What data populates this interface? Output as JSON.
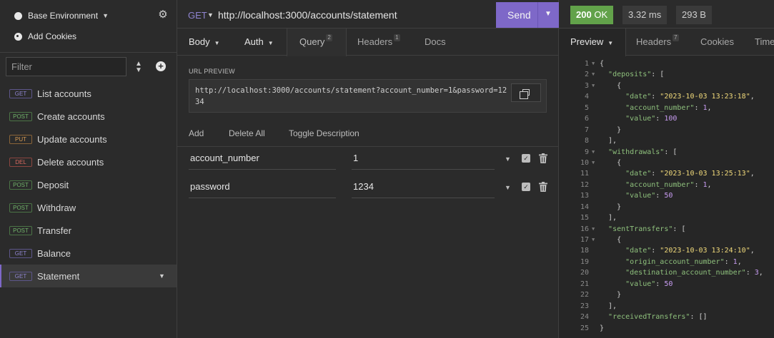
{
  "sidebar": {
    "environment": "Base Environment",
    "add_cookies": "Add Cookies",
    "filter_placeholder": "Filter",
    "requests": [
      {
        "method": "GET",
        "name": "List accounts"
      },
      {
        "method": "POST",
        "name": "Create accounts"
      },
      {
        "method": "PUT",
        "name": "Update accounts"
      },
      {
        "method": "DEL",
        "name": "Delete accounts"
      },
      {
        "method": "POST",
        "name": "Deposit"
      },
      {
        "method": "POST",
        "name": "Withdraw"
      },
      {
        "method": "POST",
        "name": "Transfer"
      },
      {
        "method": "GET",
        "name": "Balance"
      },
      {
        "method": "GET",
        "name": "Statement"
      }
    ]
  },
  "request": {
    "method": "GET",
    "url": "http://localhost:3000/accounts/statement",
    "send_label": "Send",
    "tabs": {
      "body": "Body",
      "auth": "Auth",
      "query": "Query",
      "query_count": "2",
      "headers": "Headers",
      "headers_count": "1",
      "docs": "Docs"
    },
    "url_preview_label": "URL PREVIEW",
    "url_preview": "http://localhost:3000/accounts/statement?account_number=1&password=1234",
    "actions": {
      "add": "Add",
      "delete_all": "Delete All",
      "toggle_description": "Toggle Description"
    },
    "params": [
      {
        "name": "account_number",
        "value": "1"
      },
      {
        "name": "password",
        "value": "1234"
      }
    ]
  },
  "response": {
    "status": "200",
    "status_text": "OK",
    "time": "3.32 ms",
    "size": "293 B",
    "tabs": {
      "preview": "Preview",
      "headers": "Headers",
      "headers_count": "7",
      "cookies": "Cookies",
      "timeline": "Time"
    }
  },
  "colors": {
    "accent": "#7e68c8",
    "status_ok": "#62a24a",
    "json_key": "#8ec07c",
    "json_string": "#f0d97a",
    "json_number": "#c89cf2"
  }
}
